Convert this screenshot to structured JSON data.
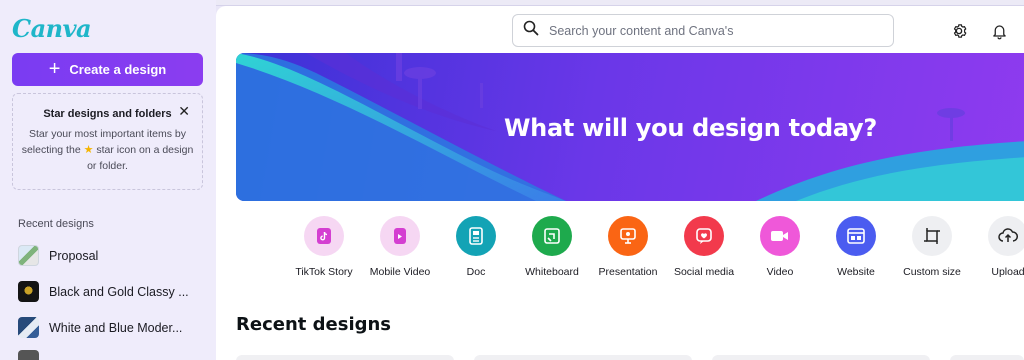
{
  "app": {
    "logo_text": "Canva"
  },
  "sidebar": {
    "create_label": "Create a design",
    "star_card": {
      "title": "Star designs and folders",
      "body_before": "Star your most important items by selecting the",
      "body_after": "star icon on a design or folder."
    },
    "recent_label": "Recent designs",
    "recent_items": [
      {
        "label": "Proposal"
      },
      {
        "label": "Black and Gold Classy ..."
      },
      {
        "label": "White and Blue Moder..."
      }
    ]
  },
  "header": {
    "search_placeholder": "Search your content and Canva's"
  },
  "hero": {
    "title": "What will you design today?"
  },
  "categories": [
    {
      "label": "TikTok Story",
      "color": "#f6d7f3",
      "icon": "tiktok-icon"
    },
    {
      "label": "Mobile Video",
      "color": "#f6d7f3",
      "icon": "mobile-video-icon"
    },
    {
      "label": "Doc",
      "color": "#13a3b5",
      "icon": "doc-icon"
    },
    {
      "label": "Whiteboard",
      "color": "#1eaa4d",
      "icon": "whiteboard-icon"
    },
    {
      "label": "Presentation",
      "color": "#fa6514",
      "icon": "presentation-icon"
    },
    {
      "label": "Social media",
      "color": "#f23a4c",
      "icon": "social-media-icon"
    },
    {
      "label": "Video",
      "color": "#ef58d9",
      "icon": "video-icon"
    },
    {
      "label": "Website",
      "color": "#4b5cf0",
      "icon": "website-icon"
    },
    {
      "label": "Custom size",
      "color": "#eeeff2",
      "icon": "custom-size-icon"
    },
    {
      "label": "Upload",
      "color": "#eeeff2",
      "icon": "upload-icon"
    }
  ],
  "main": {
    "recent_heading": "Recent designs"
  }
}
